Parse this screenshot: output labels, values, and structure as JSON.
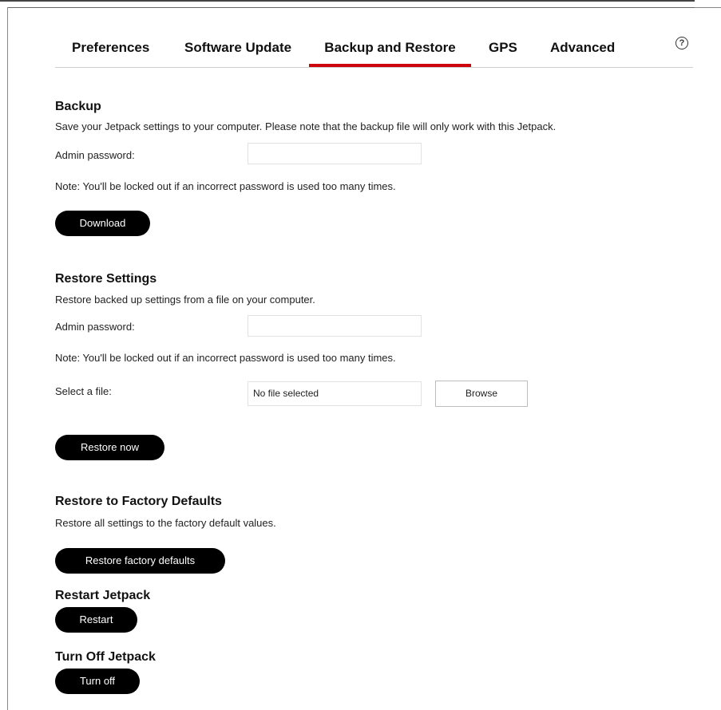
{
  "tabs": [
    "Preferences",
    "Software Update",
    "Backup and Restore",
    "GPS",
    "Advanced"
  ],
  "active_tab": "Backup and Restore",
  "help_glyph": "?",
  "accent_color": "#cd040b",
  "backup": {
    "title": "Backup",
    "description": "Save your Jetpack settings to your computer. Please note that the backup file will only work with this Jetpack.",
    "password_label": "Admin password:",
    "password_value": "",
    "note": "Note: You'll be locked out if an incorrect password is used too many times.",
    "button": "Download"
  },
  "restore": {
    "title": "Restore Settings",
    "description": "Restore backed up settings from a file on your computer.",
    "password_label": "Admin password:",
    "password_value": "",
    "note": "Note: You'll be locked out if an incorrect password is used too many times.",
    "file_label": "Select a file:",
    "file_value": "No file selected",
    "browse": "Browse",
    "button": "Restore now"
  },
  "factory": {
    "title": "Restore to Factory Defaults",
    "description": "Restore all settings to the factory default values.",
    "button": "Restore factory defaults"
  },
  "restart": {
    "title": "Restart Jetpack",
    "button": "Restart"
  },
  "turnoff": {
    "title": "Turn Off Jetpack",
    "button": "Turn off"
  }
}
